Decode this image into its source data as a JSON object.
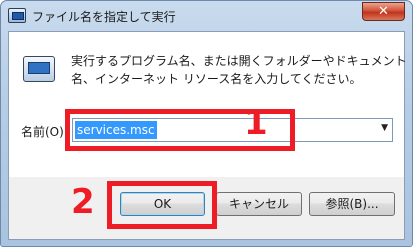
{
  "window": {
    "title": "ファイル名を指定して実行",
    "close_label": "✕"
  },
  "description": {
    "line1": "実行するプログラム名、または開くフォルダーやドキュメント",
    "line2": "名、インターネット リソース名を入力してください。"
  },
  "name_field": {
    "label": "名前(O):",
    "value": "services.msc",
    "dropdown_icon": "▼"
  },
  "buttons": {
    "ok": "OK",
    "cancel": "キャンセル",
    "browse": "参照(B)..."
  },
  "annotations": {
    "step1": "1",
    "step2": "2",
    "color": "#ee1c24"
  }
}
